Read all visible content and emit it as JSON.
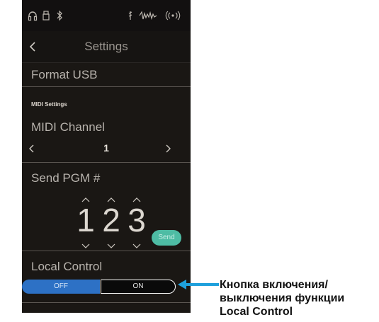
{
  "screen": {
    "status_icons": [
      "headphones-icon",
      "usb-icon",
      "bluetooth-icon",
      "audio-icon",
      "wave-icon",
      "wireless-icon"
    ],
    "nav": {
      "title": "Settings",
      "back_icon": "chevron-left-icon"
    },
    "format_usb_label": "Format USB",
    "midi_section_label": "MIDI Settings",
    "midi_channel": {
      "label": "MIDI Channel",
      "value": "1"
    },
    "send_pgm": {
      "label": "Send PGM #",
      "digits": [
        "1",
        "2",
        "3"
      ],
      "send_label": "Send"
    },
    "local_control": {
      "label": "Local Control",
      "off_label": "OFF",
      "on_label": "ON",
      "selected": "OFF"
    },
    "colors": {
      "accent_blue": "#2d71c5",
      "send_green": "#4ebca4",
      "annotation_arrow": "#1ea0dc"
    }
  },
  "annotation": {
    "lines": [
      "Кнопка включения/",
      "выключения функции",
      "Local Control"
    ]
  }
}
